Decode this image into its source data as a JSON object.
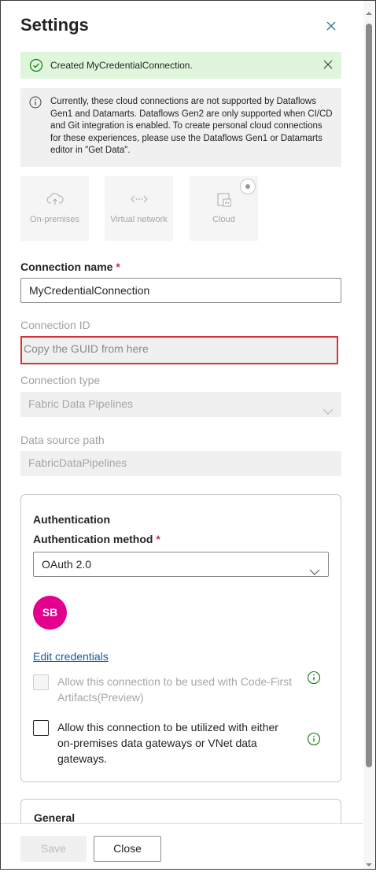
{
  "panel": {
    "title": "Settings"
  },
  "success_banner": {
    "text": "Created MyCredentialConnection."
  },
  "info_banner": {
    "text": "Currently, these cloud connections are not supported by Dataflows Gen1 and Datamarts. Dataflows Gen2 are only supported when CI/CD and Git integration is enabled. To create personal cloud connections for these experiences, please use the Dataflows Gen1 or Datamarts editor in \"Get Data\"."
  },
  "connection_types": [
    {
      "label": "On-premises",
      "icon": "cloud-upload-icon"
    },
    {
      "label": "Virtual network",
      "icon": "virtual-network-icon"
    },
    {
      "label": "Cloud",
      "icon": "cloud-grid-icon",
      "selected": true
    }
  ],
  "form": {
    "connection_name_label": "Connection name",
    "connection_name_value": "MyCredentialConnection",
    "connection_id_label": "Connection ID",
    "connection_id_value": "Copy the GUID from here",
    "connection_type_label": "Connection type",
    "connection_type_value": "Fabric Data Pipelines",
    "data_source_path_label": "Data source path",
    "data_source_path_value": "FabricDataPipelines",
    "required_marker": "*"
  },
  "authentication": {
    "heading": "Authentication",
    "method_label": "Authentication method",
    "method_value": "OAuth 2.0",
    "avatar_initials": "SB",
    "edit_credentials": "Edit credentials",
    "checkbox_code_first": "Allow this connection to be used with Code-First Artifacts(Preview)",
    "checkbox_gateways": "Allow this connection to be utilized with either on-premises data gateways or VNet data gateways."
  },
  "general": {
    "heading": "General"
  },
  "footer": {
    "save_label": "Save",
    "close_label": "Close"
  },
  "colors": {
    "success_bg": "#dff6dd",
    "info_bg": "#f0f0f0",
    "highlight_border": "#d13438",
    "avatar_bg": "#e3008c",
    "link": "#115ea3",
    "required": "#c4314b"
  }
}
